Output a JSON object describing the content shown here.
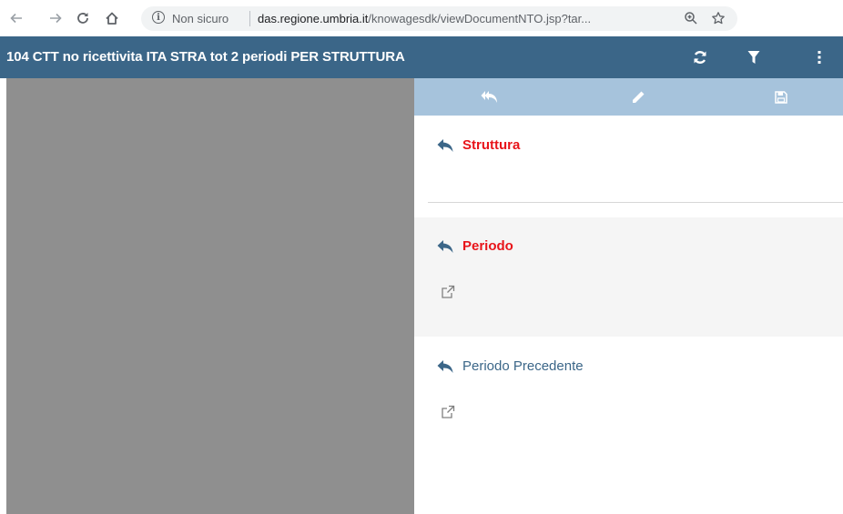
{
  "browser": {
    "security_label": "Non sicuro",
    "url_host": "das.regione.umbria.it",
    "url_path": "/knowagesdk/viewDocumentNTO.jsp?tar..."
  },
  "header": {
    "title": "104 CTT no ricettivita ITA STRA tot 2 periodi PER STRUTTURA"
  },
  "panel": {
    "sections": [
      {
        "label": "Struttura",
        "style": "required"
      },
      {
        "label": "Periodo",
        "style": "required"
      },
      {
        "label": "Periodo Precedente",
        "style": "optional"
      }
    ]
  },
  "colors": {
    "header_bg": "#3b6688",
    "panel_toolbar_bg": "#a6c3dc",
    "required_label": "#e8141a",
    "optional_label": "#3b6688",
    "viewer_bg": "#8f8f8f"
  },
  "icons": [
    "back-icon",
    "forward-icon",
    "reload-icon",
    "home-icon",
    "info-icon",
    "zoom-icon",
    "star-icon",
    "refresh-icon",
    "filter-icon",
    "kebab-menu-icon",
    "reset-all-icon",
    "edit-icon",
    "save-icon",
    "reply-arrow-icon",
    "external-link-icon",
    "dropdown-caret-icon"
  ]
}
